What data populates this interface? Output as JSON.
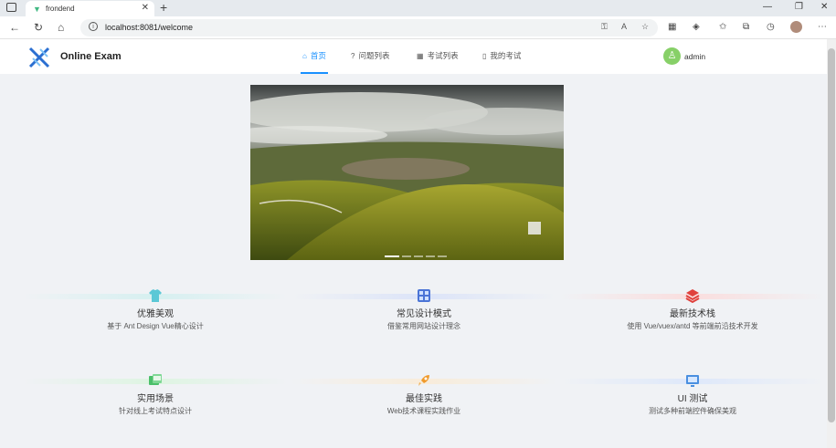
{
  "browser": {
    "tab_title": "frondend",
    "url": "localhost:8081/welcome"
  },
  "app": {
    "brand": "Online Exam",
    "menu": [
      {
        "label": "首页"
      },
      {
        "label": "问题列表"
      },
      {
        "label": "考试列表"
      },
      {
        "label": "我的考试"
      }
    ],
    "user": {
      "name": "admin"
    },
    "accent": "#1890ff"
  },
  "carousel": {
    "slide_count": 5,
    "active_index": 0
  },
  "features": [
    {
      "title": "优雅美观",
      "desc": "基于 Ant Design Vue精心设计",
      "icon": "tshirt-icon"
    },
    {
      "title": "常见设计模式",
      "desc": "借鉴常用网站设计理念",
      "icon": "grid-apps-icon"
    },
    {
      "title": "最新技术栈",
      "desc": "使用 Vue/vuex/antd 等前端前沿技术开发",
      "icon": "layers-stack-icon"
    },
    {
      "title": "实用场景",
      "desc": "针对线上考试特点设计",
      "icon": "monitor-scene-icon"
    },
    {
      "title": "最佳实践",
      "desc": "Web技术课程实践作业",
      "icon": "rocket-icon"
    },
    {
      "title": "UI 测试",
      "desc": "测试多种前端控件确保美观",
      "icon": "screen-icon"
    }
  ]
}
